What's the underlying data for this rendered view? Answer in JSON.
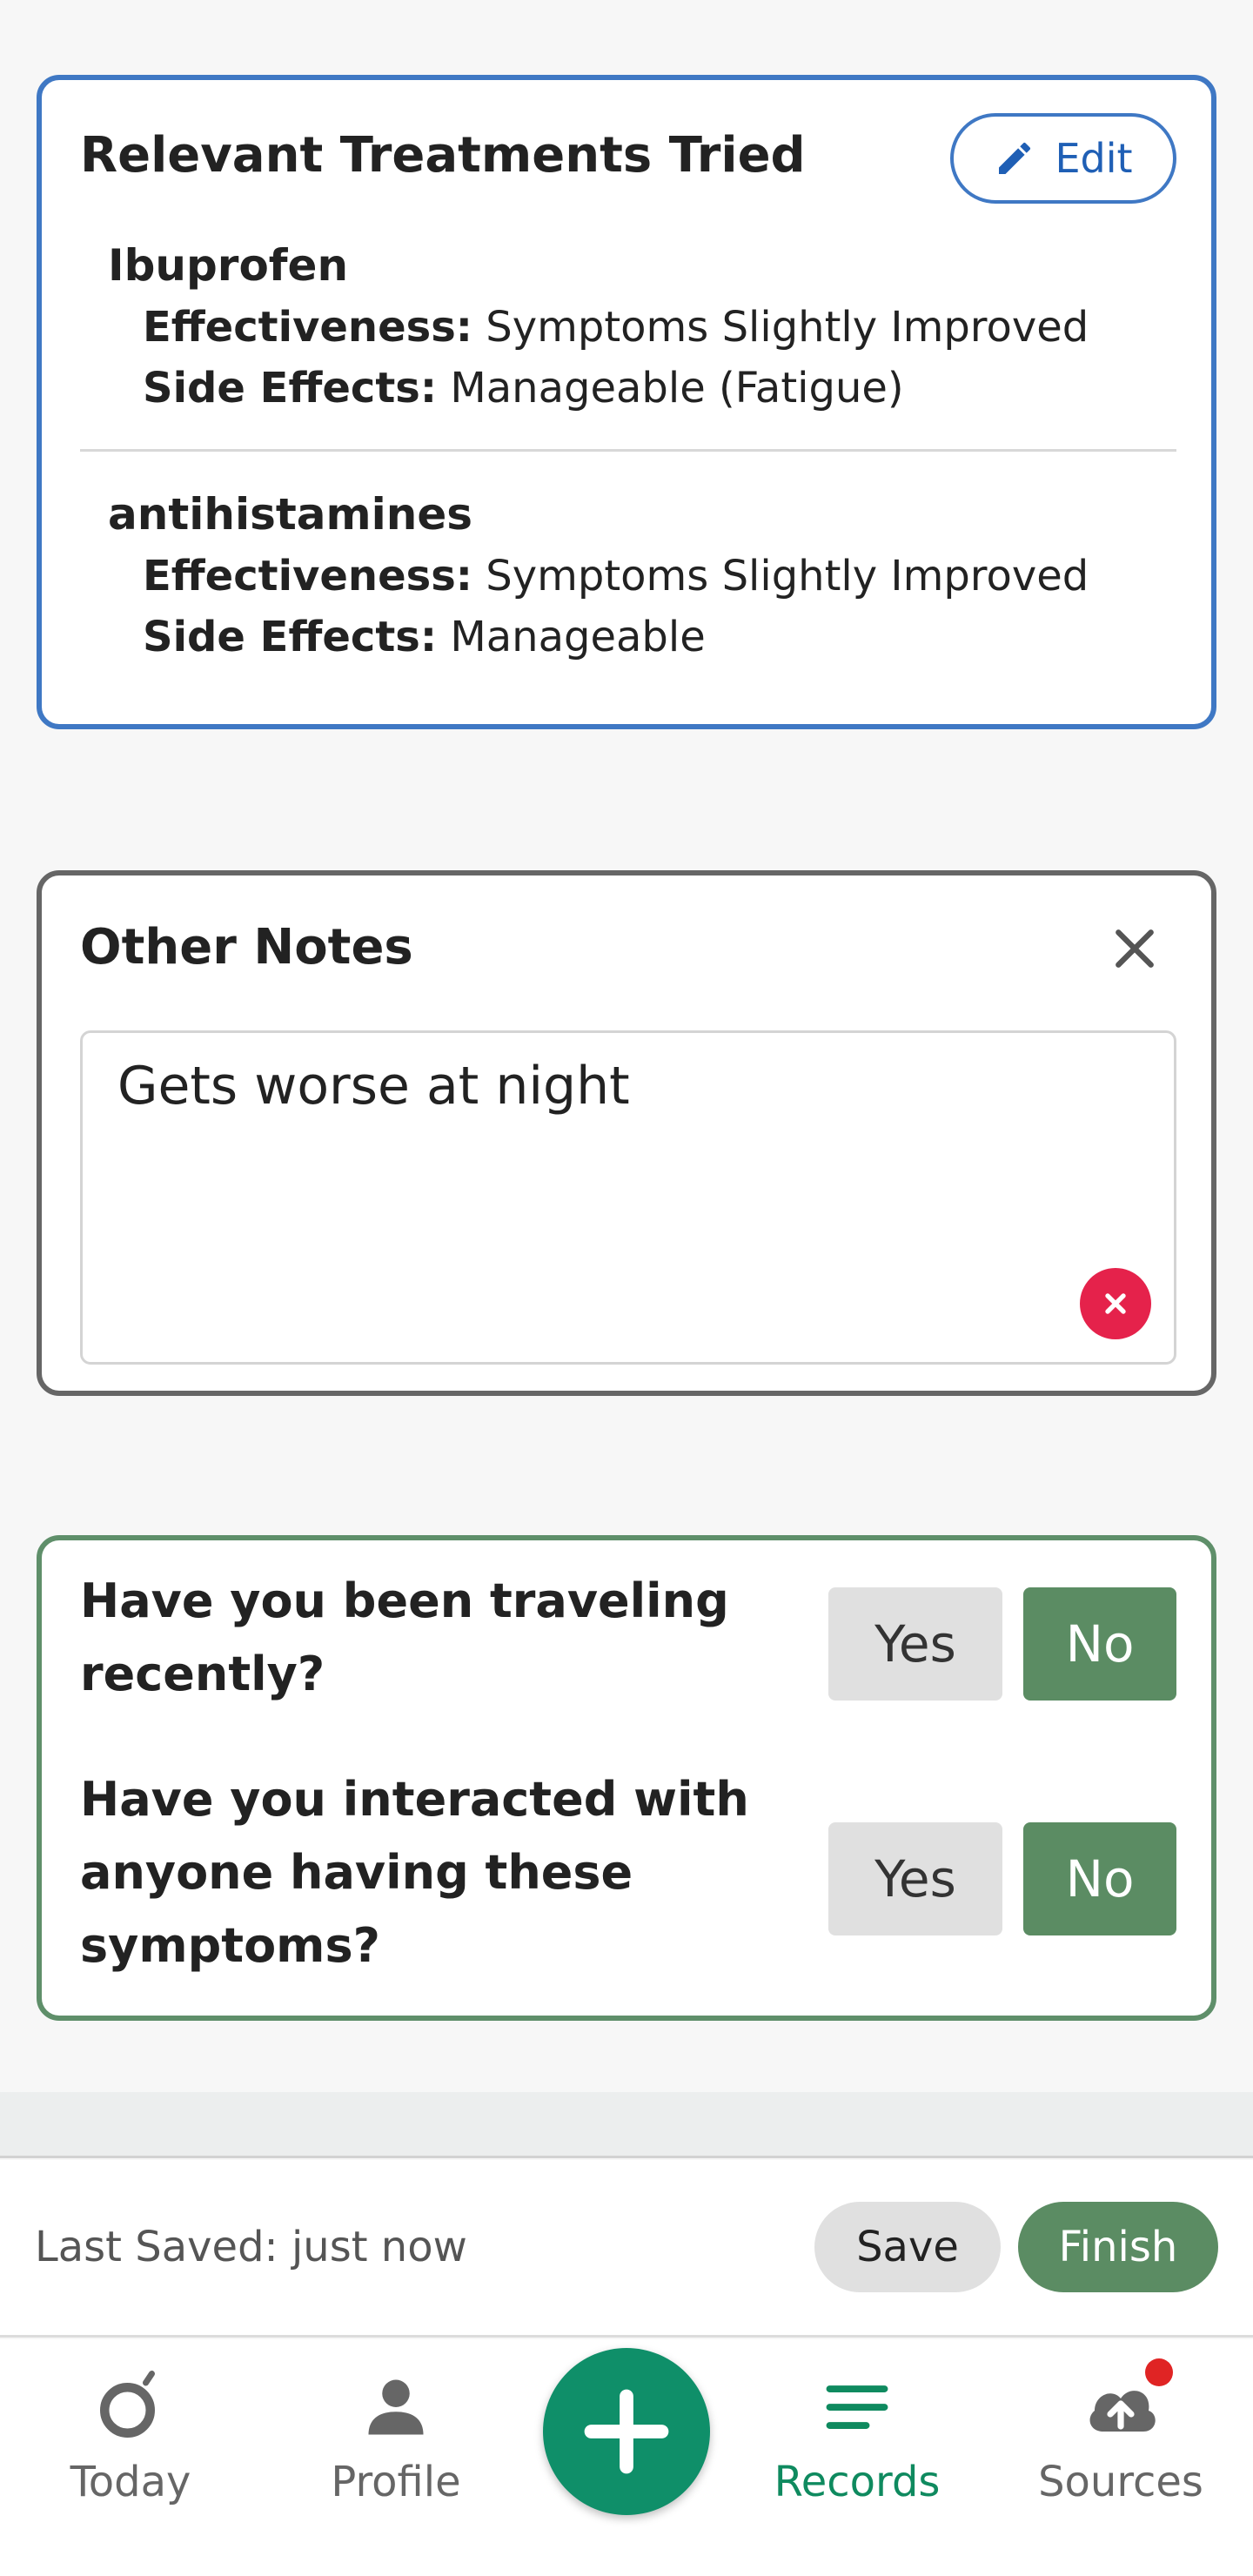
{
  "treatments": {
    "title": "Relevant Treatments Tried",
    "edit_label": "Edit",
    "items": [
      {
        "name": "Ibuprofen",
        "effectiveness_label": "Effectiveness:",
        "effectiveness": "Symptoms Slightly Improved",
        "side_effects_label": "Side Effects:",
        "side_effects": "Manageable (Fatigue)"
      },
      {
        "name": "antihistamines",
        "effectiveness_label": "Effectiveness:",
        "effectiveness": "Symptoms Slightly Improved",
        "side_effects_label": "Side Effects:",
        "side_effects": "Manageable"
      }
    ]
  },
  "notes": {
    "title": "Other Notes",
    "value": "Gets worse at night"
  },
  "questions": [
    {
      "text": "Have you been traveling recently?",
      "yes": "Yes",
      "no": "No",
      "selected": "No"
    },
    {
      "text": "Have you interacted with anyone having these symptoms?",
      "yes": "Yes",
      "no": "No",
      "selected": "No"
    }
  ],
  "save_bar": {
    "last_saved": "Last Saved: just now",
    "save_label": "Save",
    "finish_label": "Finish"
  },
  "nav": {
    "items": [
      {
        "label": "Today",
        "icon": "today-ring-icon"
      },
      {
        "label": "Profile",
        "icon": "person-icon"
      },
      {
        "label": "Records",
        "icon": "records-lines-icon",
        "active": true
      },
      {
        "label": "Sources",
        "icon": "cloud-upload-icon",
        "badge": true
      }
    ],
    "fab_icon": "plus-icon"
  },
  "colors": {
    "treatments_border": "#3f78c4",
    "notes_border": "#666666",
    "questions_border": "#5f8f6a",
    "selected_green": "#5b8c63",
    "brand_teal": "#0f8f69",
    "clear_red": "#e5224b"
  }
}
